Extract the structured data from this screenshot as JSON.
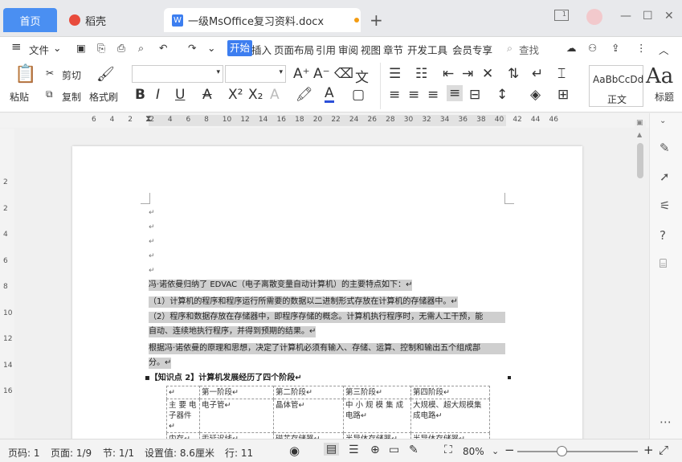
{
  "tabs": {
    "home": "首页",
    "doke": "稻壳",
    "document": "一级MsOffice复习资料.docx"
  },
  "menu": {
    "file": "文件",
    "items": [
      "开始",
      "插入",
      "页面布局",
      "引用",
      "审阅",
      "视图",
      "章节",
      "开发工具",
      "会员专享"
    ],
    "search": "查找"
  },
  "ribbon": {
    "paste": "粘贴",
    "cut": "剪切",
    "copy": "复制",
    "format_painter": "格式刷",
    "style_normal_preview": "AaBbCcDd",
    "style_normal": "正文",
    "style_heading_preview": "Aa",
    "style_heading": "标题"
  },
  "ruler_numbers": [
    "6",
    "4",
    "2",
    "2",
    "4",
    "6",
    "8",
    "10",
    "12",
    "14",
    "16",
    "18",
    "20",
    "22",
    "24",
    "26",
    "28",
    "30",
    "32",
    "34",
    "36",
    "38",
    "40",
    "42",
    "44",
    "46"
  ],
  "vruler_numbers": [
    "2",
    "2",
    "4",
    "6",
    "8",
    "10",
    "12",
    "14",
    "16"
  ],
  "document": {
    "p1": "冯·诺依曼归纳了 EDVAC（电子离散变量自动计算机）的主要特点如下：",
    "p2": "（1）计算机的程序和程序运行所需要的数据以二进制形式存放在计算机的存储器中。",
    "p3a": "（2）程序和数据存放在存储器中，即程序存储的概念。计算机执行程序时，无需人工干预，能",
    "p3b": "自动、连续地执行程序，并得到预期的结果。",
    "p4a": "根据冯·诺依曼的原理和思想，决定了计算机必须有输入、存储、运算、控制和输出五个组成部",
    "p4b": "分。",
    "heading": "【知识点 2】计算机发展经历了四个阶段",
    "table": [
      [
        "",
        "第一阶段",
        "第二阶段",
        "第三阶段",
        "第四阶段"
      ],
      [
        "主 要 电子器件",
        "电子管",
        "晶体管",
        "中 小 规 模 集 成 电路",
        "大规模、超大规模集成电路"
      ],
      [
        "内存",
        "汞延迟线",
        "磁芯存储器",
        "半导体存储器",
        "半导体存储器"
      ]
    ]
  },
  "status": {
    "page": "页码: 1",
    "pages": "页面: 1/9",
    "section": "节: 1/1",
    "setting": "设置值: 8.6厘米",
    "line": "行: 11",
    "zoom": "80%"
  },
  "colors": {
    "accent": "#3d7ef0",
    "highlight": "#cfcfcf"
  }
}
